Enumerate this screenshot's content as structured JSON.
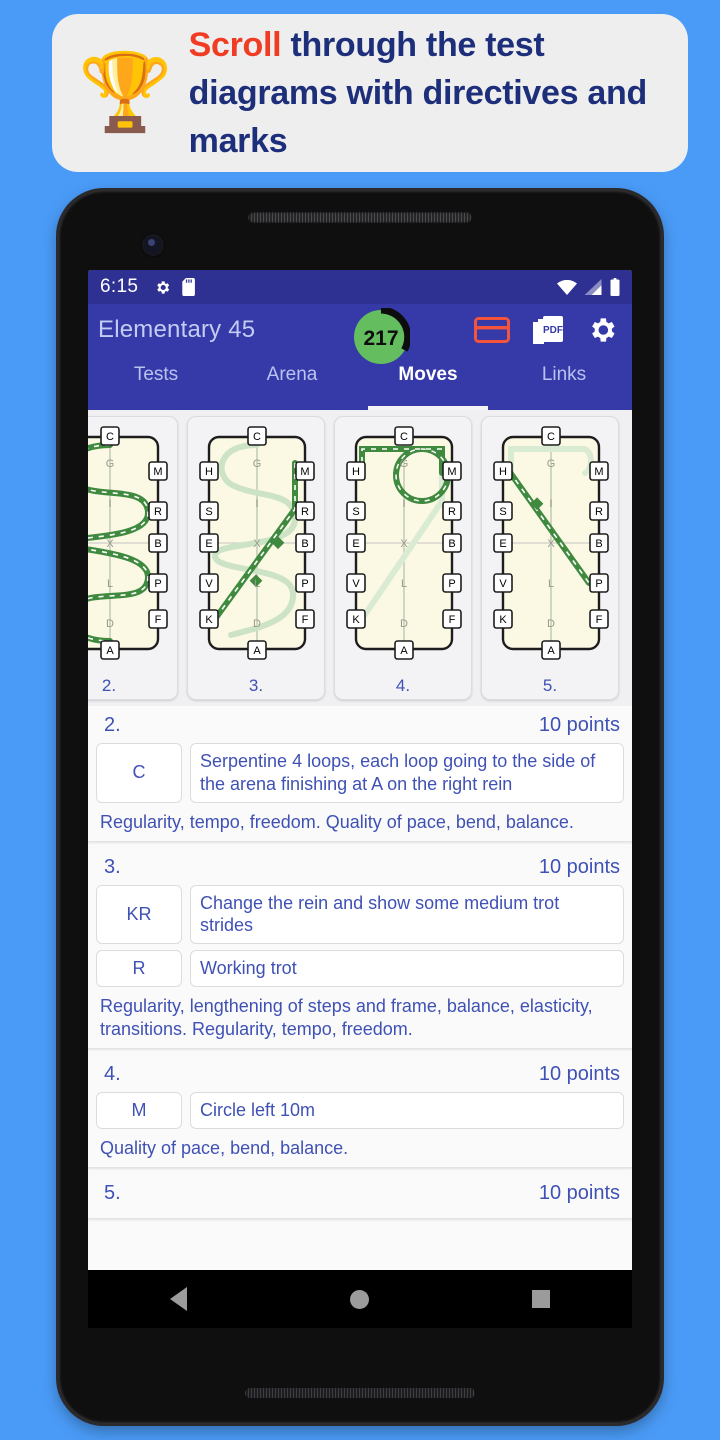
{
  "promo": {
    "emoji": "🏆",
    "highlight": "Scroll",
    "rest": " through the test diagrams with directives and marks"
  },
  "status_bar": {
    "time": "6:15",
    "left_icons": [
      "gear-icon",
      "sd-card-icon"
    ],
    "right_icons": [
      "wifi-icon",
      "signal-icon",
      "battery-icon"
    ]
  },
  "app_bar": {
    "title": "Elementary 45",
    "badge_value": "217",
    "badge_color": "#64bd5e",
    "actions": [
      "card-icon",
      "pdf-icon",
      "gear-icon"
    ],
    "accent": "#3639a8",
    "card_icon_color": "#f4543c"
  },
  "tabs": [
    {
      "label": "Tests",
      "active": false
    },
    {
      "label": "Arena",
      "active": false
    },
    {
      "label": "Moves",
      "active": true
    },
    {
      "label": "Links",
      "active": false
    }
  ],
  "arena_letters": {
    "top": "C",
    "bottom": "A",
    "left": [
      "H",
      "S",
      "E",
      "V",
      "K"
    ],
    "right": [
      "M",
      "R",
      "B",
      "P",
      "F"
    ],
    "center": [
      "G",
      "I",
      "X",
      "L",
      "D"
    ]
  },
  "diagrams": [
    {
      "label": "2.",
      "shape": "serpentine"
    },
    {
      "label": "3.",
      "shape": "diagonal-kr"
    },
    {
      "label": "4.",
      "shape": "circle-left-10m"
    },
    {
      "label": "5.",
      "shape": "diagonal-hf"
    }
  ],
  "movements": [
    {
      "number": "2.",
      "points": "10 points",
      "rows": [
        {
          "letter": "C",
          "description": "Serpentine 4 loops, each loop going to the side of the arena finishing at A on the right rein"
        }
      ],
      "directive": "Regularity, tempo, freedom. Quality of pace, bend, balance."
    },
    {
      "number": "3.",
      "points": "10 points",
      "rows": [
        {
          "letter": "KR",
          "description": "Change the rein and show some medium trot strides"
        },
        {
          "letter": "R",
          "description": "Working trot"
        }
      ],
      "directive": "Regularity, lengthening of steps and frame, balance, elasticity, transitions. Regularity, tempo, freedom."
    },
    {
      "number": "4.",
      "points": "10 points",
      "rows": [
        {
          "letter": "M",
          "description": "Circle left 10m"
        }
      ],
      "directive": "Quality of pace, bend, balance."
    },
    {
      "number": "5.",
      "points": "10 points",
      "rows": [],
      "directive": ""
    }
  ],
  "nav_bar": {
    "back": "back-icon",
    "home": "home-icon",
    "recents": "recents-icon"
  },
  "colors": {
    "page_background": "#4a9bf7",
    "banner_background": "#eeeeee",
    "title_blue": "#1d2f7a",
    "highlight_red": "#f03c22",
    "text_indigo": "#3f51b5",
    "path_green": "#3f8a3f",
    "arena_fill": "#fbf8e4"
  }
}
